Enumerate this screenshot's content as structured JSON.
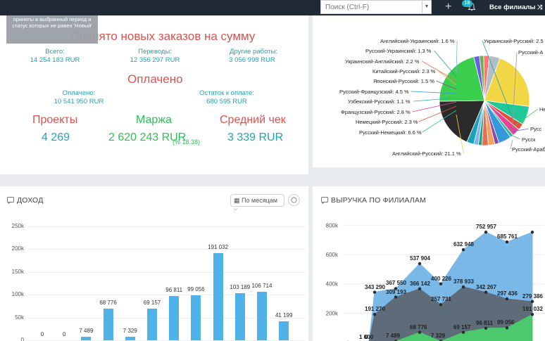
{
  "topbar": {
    "search_placeholder": "Поиск (Ctrl-F)",
    "notification_count": "18",
    "branches_label": "Все филиалы"
  },
  "summary": {
    "tooltip": "приняты в выбранный период и статус которых не равен 'Новый'",
    "orders_title": "Принято новых заказов на сумму",
    "total_label": "Всего:",
    "total_value": "14 254 183 RUR",
    "translations_label": "Переводы:",
    "translations_value": "12 356 297 RUR",
    "other_label": "Другие работы:",
    "other_value": "3 056 998 RUR",
    "paid_title": "Оплачено",
    "paid_label": "Оплачено:",
    "paid_value": "10 541 950 RUR",
    "due_label": "Остаток к оплате:",
    "due_value": "680 595 RUR",
    "projects_label": "Проекты",
    "projects_value": "4 269",
    "margin_label": "Маржа",
    "margin_value": "2 620 243 RUR",
    "margin_pct": "(18.38 %)",
    "avg_label": "Средний чек",
    "avg_value": "3 339 RUR"
  },
  "income_panel": {
    "title": "ДОХОД",
    "period_select": "По месяцам",
    "yticks": [
      "250k",
      "200k",
      "150k",
      "100k",
      "50k",
      "0"
    ]
  },
  "branch_panel": {
    "title": "ВЫРУЧКА ПО ФИЛИАЛАМ",
    "yticks": [
      "800k",
      "600k",
      "400k",
      "200k"
    ]
  },
  "chart_data": [
    {
      "type": "pie",
      "labels": [
        {
          "text": "Английский-Украинский: 1.6 %",
          "color": "#7cb5ec"
        },
        {
          "text": "Русский-Украинский: 1.3 %",
          "color": "#2a9d8f"
        },
        {
          "text": "Украинский-Английский: 2.2 %",
          "color": "#e76f51"
        },
        {
          "text": "Китайский-Русский: 2.3 %",
          "color": "#f4a261"
        },
        {
          "text": "Японский-Русский: 1.5 %",
          "color": "#8e44ad"
        },
        {
          "text": "Русский-Французский: 4.5 %",
          "color": "#3498db"
        },
        {
          "text": "Узбекский-Русский: 1.1 %",
          "color": "#1abc9c"
        },
        {
          "text": "Французский-Русский: 2.8 %",
          "color": "#e84393"
        },
        {
          "text": "Немецкий-Русский: 2.3 %",
          "color": "#e74c3c"
        },
        {
          "text": "Русский-Немецкий: 6.6 %",
          "color": "#20c997"
        },
        {
          "text": "Английский-Русский: 21.1 %",
          "color": "#f2d643"
        },
        {
          "text": "Украинский-Русский: 2.5 %",
          "color": "#17a2b8"
        },
        {
          "text": "Русский-А",
          "color": "#999999"
        },
        {
          "text": "Не",
          "color": "#3ccf4e"
        },
        {
          "text": "Русс",
          "color": "#6c5ce7"
        },
        {
          "text": "Русск",
          "color": "#6ab04c"
        },
        {
          "text": "Русский-Арабск",
          "color": "#ff7675"
        }
      ],
      "slices": [
        {
          "value": 21.1,
          "color": "#f2d643"
        },
        {
          "value": 6.6,
          "color": "#20c997"
        },
        {
          "value": 2.3,
          "color": "#e74c3c"
        },
        {
          "value": 2.8,
          "color": "#e84393"
        },
        {
          "value": 1.1,
          "color": "#1abc9c"
        },
        {
          "value": 4.5,
          "color": "#3498db"
        },
        {
          "value": 1.5,
          "color": "#8e44ad"
        },
        {
          "value": 2.3,
          "color": "#f4a261"
        },
        {
          "value": 2.2,
          "color": "#e76f51"
        },
        {
          "value": 1.3,
          "color": "#2a9d8f"
        },
        {
          "value": 1.6,
          "color": "#7cb5ec"
        },
        {
          "value": 2.5,
          "color": "#17a2b8"
        },
        {
          "value": 18.0,
          "color": "#2b2b2b"
        },
        {
          "value": 21.0,
          "color": "#3ccf4e"
        },
        {
          "value": 2.0,
          "color": "#6c5ce7"
        },
        {
          "value": 1.5,
          "color": "#6ab04c"
        },
        {
          "value": 2.0,
          "color": "#ff7675"
        },
        {
          "value": 3.7,
          "color": "#b0bec5"
        }
      ]
    },
    {
      "type": "bar",
      "values": [
        0,
        0,
        7489,
        68776,
        7329,
        69157,
        96811,
        99056,
        191032,
        103189,
        106714,
        41199
      ],
      "labels": [
        "0",
        "0",
        "7 489",
        "68 776",
        "7 329",
        "69 157",
        "96 811",
        "99 056",
        "191 032",
        "103 189",
        "106 714",
        "41 199"
      ],
      "ylim": [
        0,
        250000
      ],
      "color": "#4fb3ea"
    },
    {
      "type": "area",
      "ylim": [
        0,
        850000
      ],
      "series": [
        {
          "color": "#7ab8e8",
          "values": [
            0,
            0,
            343290,
            367550,
            537904,
            400226,
            632948,
            752957,
            685761,
            752957
          ]
        },
        {
          "color": "#5e6b78",
          "values": [
            0,
            0,
            191270,
            309193,
            366142,
            257731,
            378933,
            342267,
            297436,
            279386
          ]
        },
        {
          "color": "#4cc96d",
          "values": [
            0,
            0,
            0,
            7489,
            68776,
            7329,
            69157,
            96811,
            99056,
            191032
          ]
        }
      ],
      "labels": [
        {
          "text": "343 290",
          "v": 343290,
          "i": 2
        },
        {
          "text": "367 550",
          "v": 367550,
          "i": 3
        },
        {
          "text": "537 904",
          "v": 537904,
          "i": 4
        },
        {
          "text": "400 226",
          "v": 400226,
          "i": 5
        },
        {
          "text": "632 948",
          "v": 632948,
          "i": 6
        },
        {
          "text": "752 957",
          "v": 752957,
          "i": 7
        },
        {
          "text": "685 761",
          "v": 685761,
          "i": 8
        },
        {
          "text": "191 270",
          "v": 191270,
          "i": 2
        },
        {
          "text": "309 193",
          "v": 309193,
          "i": 3
        },
        {
          "text": "366 142",
          "v": 366142,
          "i": 4
        },
        {
          "text": "257 731",
          "v": 257731,
          "i": 5
        },
        {
          "text": "378 933",
          "v": 378933,
          "i": 6
        },
        {
          "text": "342 267",
          "v": 342267,
          "i": 7
        },
        {
          "text": "297 436",
          "v": 297436,
          "i": 8
        },
        {
          "text": "279 386",
          "v": 279386,
          "i": 9
        },
        {
          "text": "1 600",
          "v": 1600,
          "i": 1
        },
        {
          "text": "0",
          "v": 0,
          "i": 2
        },
        {
          "text": "7 489",
          "v": 7489,
          "i": 3
        },
        {
          "text": "68 776",
          "v": 68776,
          "i": 4
        },
        {
          "text": "7 329",
          "v": 7329,
          "i": 5
        },
        {
          "text": "69 157",
          "v": 69157,
          "i": 6
        },
        {
          "text": "96 811",
          "v": 96811,
          "i": 7
        },
        {
          "text": "99 056",
          "v": 99056,
          "i": 8
        },
        {
          "text": "191 032",
          "v": 191032,
          "i": 9
        }
      ]
    }
  ]
}
